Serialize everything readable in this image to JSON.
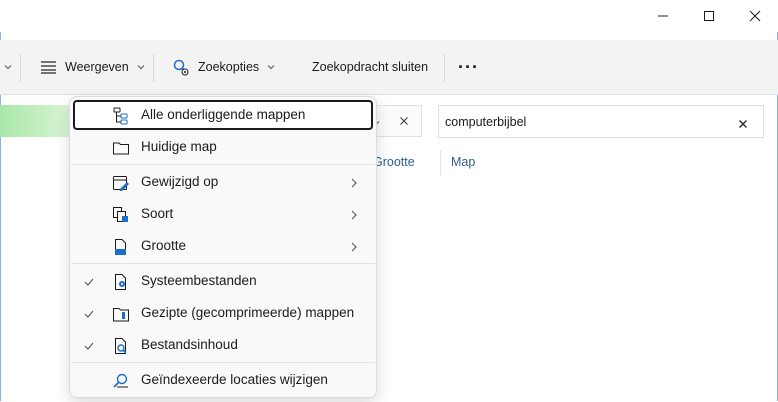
{
  "toolbar": {
    "view_label": "Weergeven",
    "search_options_label": "Zoekopties",
    "close_search_label": "Zoekopdracht sluiten",
    "more_label": "···"
  },
  "search": {
    "value": "computerbijbel"
  },
  "columns": {
    "size": "Grootte",
    "folder": "Map"
  },
  "menu": {
    "items": [
      {
        "label": "Alle onderliggende mappen",
        "icon": "subfolders-icon",
        "checked": false,
        "submenu": false,
        "focused": true
      },
      {
        "label": "Huidige map",
        "icon": "folder-icon",
        "checked": false,
        "submenu": false
      },
      {
        "label": "Gewijzigd op",
        "icon": "calendar-edit-icon",
        "checked": false,
        "submenu": true
      },
      {
        "label": "Soort",
        "icon": "file-kind-icon",
        "checked": false,
        "submenu": true
      },
      {
        "label": "Grootte",
        "icon": "file-size-icon",
        "checked": false,
        "submenu": true
      },
      {
        "label": "Systeembestanden",
        "icon": "system-file-icon",
        "checked": true,
        "submenu": false
      },
      {
        "label": "Gezipte (gecomprimeerde) mappen",
        "icon": "zip-folder-icon",
        "checked": true,
        "submenu": false
      },
      {
        "label": "Bestandsinhoud",
        "icon": "file-search-icon",
        "checked": true,
        "submenu": false
      },
      {
        "label": "Geïndexeerde locaties wijzigen",
        "icon": "search-locations-icon",
        "checked": false,
        "submenu": false
      }
    ]
  },
  "colors": {
    "accent": "#1f6cc7",
    "progress": "#a9e7a9",
    "link": "#2e5f8f"
  }
}
